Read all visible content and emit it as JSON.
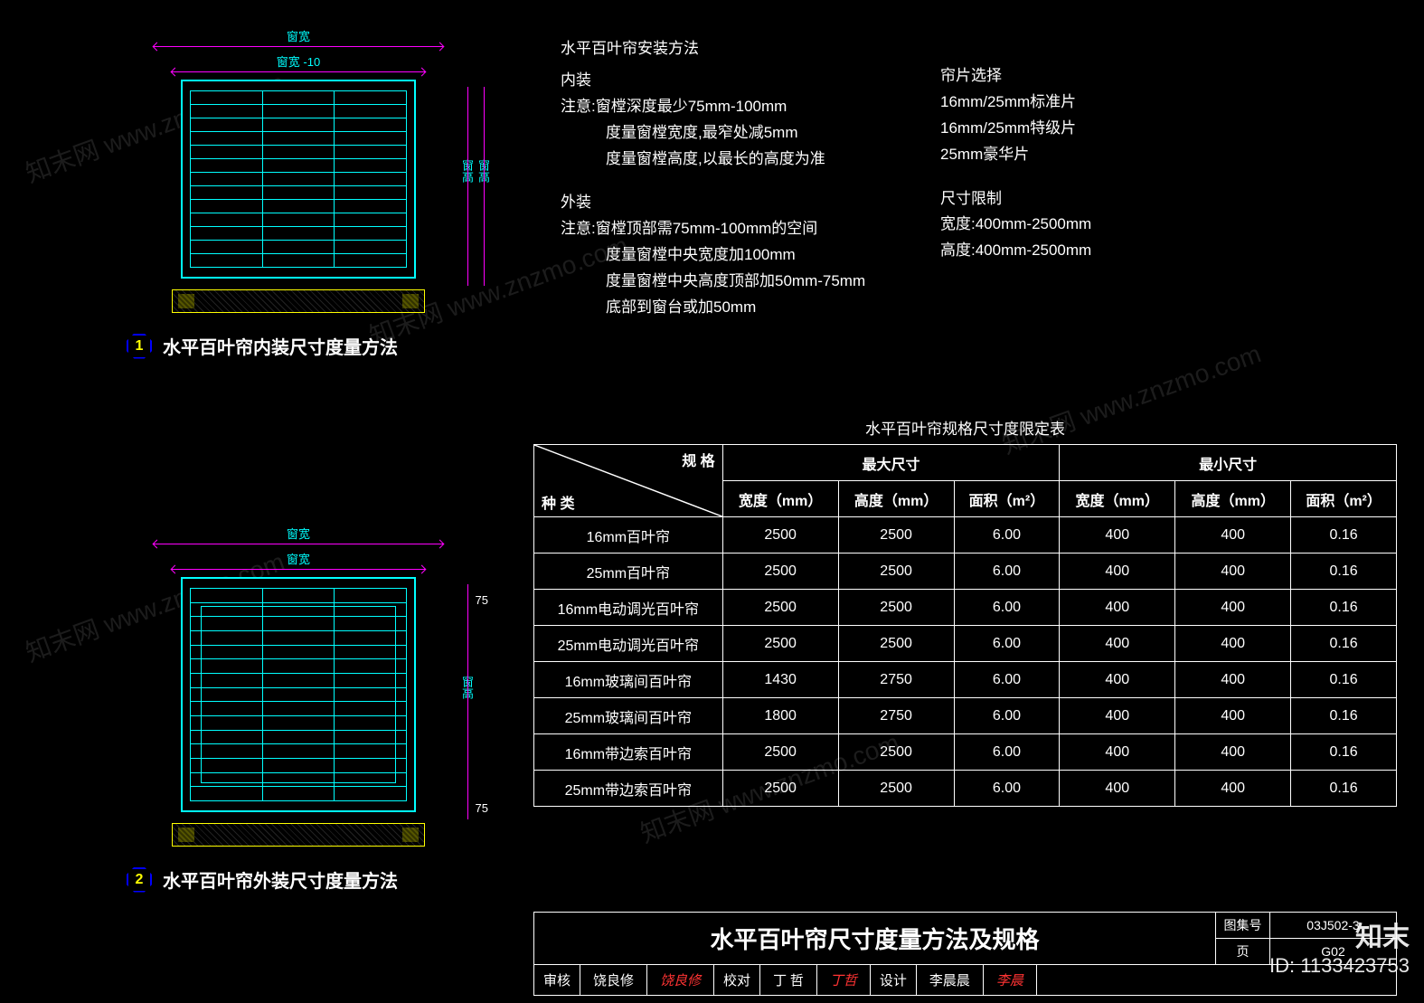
{
  "watermark": "知末网 www.znzmo.com",
  "drawing1": {
    "dim_top": "窗宽",
    "dim_top2": "窗宽 -10",
    "dim_side1": "窗高",
    "dim_side2": "窗高",
    "caption_num": "1",
    "caption": "水平百叶帘内装尺寸度量方法"
  },
  "drawing2": {
    "dim_top": "窗宽",
    "dim_top2": "窗宽",
    "dim_side": "窗高",
    "dim75a": "75",
    "dim75b": "75",
    "caption_num": "2",
    "caption": "水平百叶帘外装尺寸度量方法"
  },
  "notes": {
    "title": "水平百叶帘安装方法",
    "h1": "内装",
    "l1": "注意:窗樘深度最少75mm-100mm",
    "l2": "度量窗樘宽度,最窄处减5mm",
    "l3": "度量窗樘高度,以最长的高度为准",
    "h2": "外装",
    "l4": "注意:窗樘顶部需75mm-100mm的空间",
    "l5": "度量窗樘中央宽度加100mm",
    "l6": "度量窗樘中央高度顶部加50mm-75mm",
    "l7": "底部到窗台或加50mm"
  },
  "notes2": {
    "h1": "帘片选择",
    "l1": "16mm/25mm标准片",
    "l2": "16mm/25mm特级片",
    "l3": "25mm豪华片",
    "h2": "尺寸限制",
    "l4": "宽度:400mm-2500mm",
    "l5": "高度:400mm-2500mm"
  },
  "table": {
    "title": "水平百叶帘规格尺寸度限定表",
    "diag_top": "规 格",
    "diag_bottom": "种 类",
    "group1": "最大尺寸",
    "group2": "最小尺寸",
    "cols": [
      "宽度（mm）",
      "高度（mm）",
      "面积（m²）",
      "宽度（mm）",
      "高度（mm）",
      "面积（m²）"
    ],
    "rows": [
      {
        "name": "16mm百叶帘",
        "v": [
          "2500",
          "2500",
          "6.00",
          "400",
          "400",
          "0.16"
        ]
      },
      {
        "name": "25mm百叶帘",
        "v": [
          "2500",
          "2500",
          "6.00",
          "400",
          "400",
          "0.16"
        ]
      },
      {
        "name": "16mm电动调光百叶帘",
        "v": [
          "2500",
          "2500",
          "6.00",
          "400",
          "400",
          "0.16"
        ]
      },
      {
        "name": "25mm电动调光百叶帘",
        "v": [
          "2500",
          "2500",
          "6.00",
          "400",
          "400",
          "0.16"
        ]
      },
      {
        "name": "16mm玻璃间百叶帘",
        "v": [
          "1430",
          "2750",
          "6.00",
          "400",
          "400",
          "0.16"
        ]
      },
      {
        "name": "25mm玻璃间百叶帘",
        "v": [
          "1800",
          "2750",
          "6.00",
          "400",
          "400",
          "0.16"
        ]
      },
      {
        "name": "16mm带边索百叶帘",
        "v": [
          "2500",
          "2500",
          "6.00",
          "400",
          "400",
          "0.16"
        ]
      },
      {
        "name": "25mm带边索百叶帘",
        "v": [
          "2500",
          "2500",
          "6.00",
          "400",
          "400",
          "0.16"
        ]
      }
    ]
  },
  "titleblock": {
    "title": "水平百叶帘尺寸度量方法及规格",
    "atlas_k": "图集号",
    "atlas_v": "03J502-3",
    "page_k": "页",
    "page_v": "G02",
    "signrow": [
      {
        "k": "审核",
        "v": "饶良修",
        "sig": "饶良修"
      },
      {
        "k": "校对",
        "v": "丁 哲",
        "sig": "丁哲"
      },
      {
        "k": "设计",
        "v": "李晨晨",
        "sig": "李晨"
      }
    ]
  },
  "brand": {
    "name": "知末",
    "id": "ID: 1133423753"
  },
  "chart_data": {
    "type": "table",
    "title": "水平百叶帘规格尺寸度限定表",
    "columns": [
      "种类",
      "最大宽度(mm)",
      "最大高度(mm)",
      "最大面积(m²)",
      "最小宽度(mm)",
      "最小高度(mm)",
      "最小面积(m²)"
    ],
    "rows": [
      [
        "16mm百叶帘",
        2500,
        2500,
        6.0,
        400,
        400,
        0.16
      ],
      [
        "25mm百叶帘",
        2500,
        2500,
        6.0,
        400,
        400,
        0.16
      ],
      [
        "16mm电动调光百叶帘",
        2500,
        2500,
        6.0,
        400,
        400,
        0.16
      ],
      [
        "25mm电动调光百叶帘",
        2500,
        2500,
        6.0,
        400,
        400,
        0.16
      ],
      [
        "16mm玻璃间百叶帘",
        1430,
        2750,
        6.0,
        400,
        400,
        0.16
      ],
      [
        "25mm玻璃间百叶帘",
        1800,
        2750,
        6.0,
        400,
        400,
        0.16
      ],
      [
        "16mm带边索百叶帘",
        2500,
        2500,
        6.0,
        400,
        400,
        0.16
      ],
      [
        "25mm带边索百叶帘",
        2500,
        2500,
        6.0,
        400,
        400,
        0.16
      ]
    ]
  }
}
